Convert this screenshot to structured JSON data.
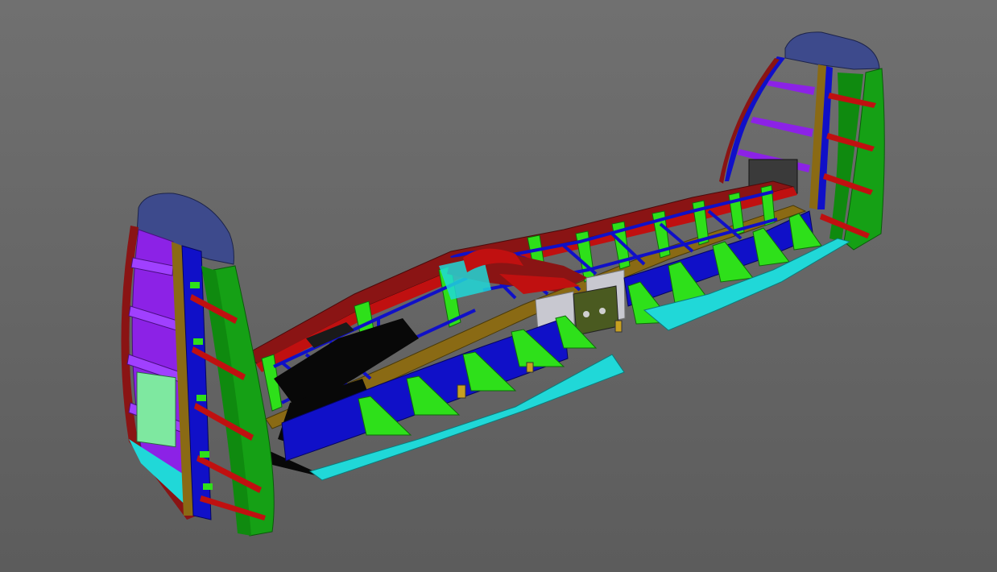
{
  "viewport": {
    "background_top": "#707070",
    "background_bottom": "#5c5c5c"
  },
  "model": {
    "part_colors": {
      "winglet_cap": "#3d4a8c",
      "winglet_skin_green": "#15a015",
      "winglet_ribs_purple": "#8c22e6",
      "red_parts": "#c01010",
      "dark_red_parts": "#8a1414",
      "blue_parts": "#1010c8",
      "bright_green_parts": "#2ee01a",
      "cyan_elevons": "#20d8d8",
      "spar_brown": "#8a6a14",
      "black_parts": "#080808",
      "light_green_panel": "#7ee8a0",
      "gray_panel": "#c8c8d0",
      "olive_panel": "#4a5a20"
    }
  }
}
